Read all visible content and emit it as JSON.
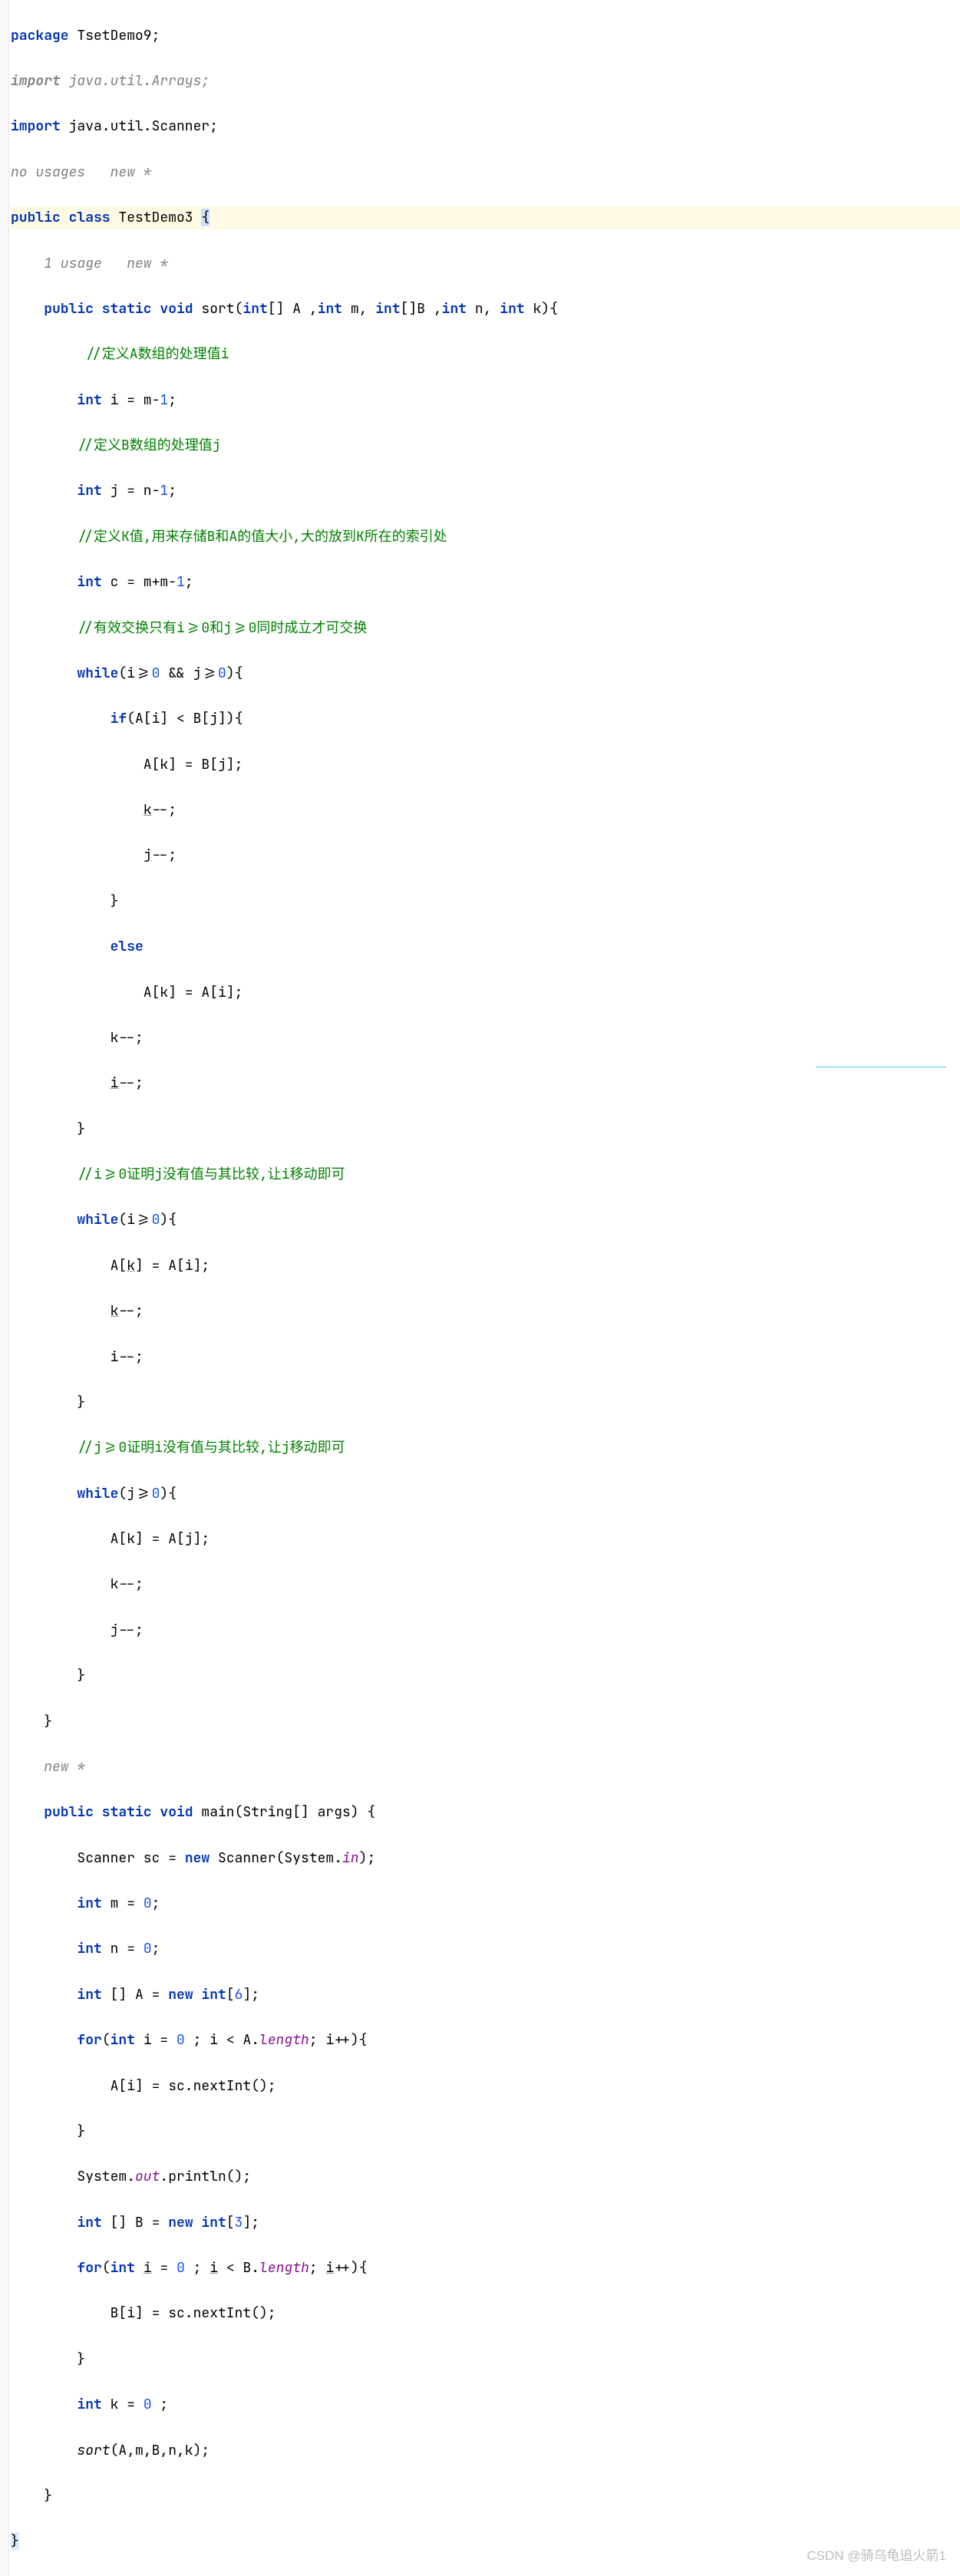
{
  "code": {
    "l1_kw": "package",
    "l1_pkg": " TsetDemo9;",
    "l2_kw": "import",
    "l2_pkg": " java.util.Arrays;",
    "l3_kw": "import",
    "l3_pkg": " java.util.Scanner;",
    "l4_hint": "no usages   new *",
    "l5_kw1": "public class",
    "l5_name": " TestDemo3 ",
    "l5_brace": "{",
    "l6_hint": "    1 usage   new *",
    "l7_kw1": "    public static void",
    "l7_name": " sort(",
    "l7_kw2": "int",
    "l7_p1": "[] A ,",
    "l7_kw3": "int",
    "l7_p2": " m, ",
    "l7_kw4": "int",
    "l7_p3": "[]B ,",
    "l7_kw5": "int",
    "l7_p4": " n, ",
    "l7_kw6": "int",
    "l7_p5": " k){",
    "l8": "         //定义A数组的处理值i",
    "l9_kw": "        int",
    "l9_rest": " i = m-",
    "l9_num": "1",
    "l9_semi": ";",
    "l10": "        //定义B数组的处理值j",
    "l11_kw": "        int",
    "l11_rest": " j = n-",
    "l11_num": "1",
    "l11_semi": ";",
    "l12": "        //定义K值,用来存储B和A的值大小,大的放到K所在的索引处",
    "l13_kw": "        int",
    "l13_rest": " c = m+m-",
    "l13_num": "1",
    "l13_semi": ";",
    "l14": "        //有效交换只有i>=0和j>=0同时成立才可交换",
    "l15_kw": "        while",
    "l15_rest": "(i>=",
    "l15_n1": "0",
    "l15_mid": " && j>=",
    "l15_n2": "0",
    "l15_end": "){",
    "l16_kw": "            if",
    "l16_rest": "(A[i] < B[j]){",
    "l17": "                A[k] = B[j];",
    "l18_a": "                ",
    "l18_b": "k",
    "l18_c": "--;",
    "l19_a": "                ",
    "l19_b": "j",
    "l19_c": "--;",
    "l20": "            }",
    "l21_kw": "            else",
    "l22": "                A[k] = A[i];",
    "l23": "            k--;",
    "l24_a": "            ",
    "l24_b": "i",
    "l24_c": "--;",
    "l25": "        }",
    "l26": "        //i>=0证明j没有值与其比较,让i移动即可",
    "l27_kw": "        while",
    "l27_rest": "(i>=",
    "l27_n": "0",
    "l27_end": "){",
    "l28_a": "            A[",
    "l28_b": "k",
    "l28_c": "] = A[i];",
    "l29_a": "            ",
    "l29_b": "k",
    "l29_c": "--;",
    "l30": "            i--;",
    "l31": "        }",
    "l32": "        //j>=0证明i没有值与其比较,让j移动即可",
    "l33_kw": "        while",
    "l33_rest": "(j>=",
    "l33_n": "0",
    "l33_end": "){",
    "l34": "            A[k] = A[j];",
    "l35": "            k--;",
    "l36": "            j--;",
    "l37": "        }",
    "l38": "    }",
    "l39_hint": "    new *",
    "l40_kw": "    public static void",
    "l40_name": " main(String[] args) {",
    "l41a": "        Scanner sc = ",
    "l41_kw": "new",
    "l41b": " Scanner(System.",
    "l41_field": "in",
    "l41c": ");",
    "l42_kw": "        int",
    "l42_rest": " m = ",
    "l42_n": "0",
    "l42_semi": ";",
    "l43_kw": "        int",
    "l43_rest": " n = ",
    "l43_n": "0",
    "l43_semi": ";",
    "l44_kw": "        int",
    "l44_a": " [] A = ",
    "l44_kw2": "new int",
    "l44_b": "[",
    "l44_n": "6",
    "l44_c": "];",
    "l45_kw": "        for",
    "l45_a": "(",
    "l45_kw2": "int",
    "l45_b": " i = ",
    "l45_n": "0",
    "l45_c": " ; i < A.",
    "l45_field": "length",
    "l45_d": "; i++){",
    "l46": "            A[i] = sc.nextInt();",
    "l47": "        }",
    "l48a": "        System.",
    "l48_field": "out",
    "l48b": ".println();",
    "l49_kw": "        int",
    "l49_a": " [] B = ",
    "l49_kw2": "new int",
    "l49_b": "[",
    "l49_n": "3",
    "l49_c": "];",
    "l50_kw": "        for",
    "l50_a": "(",
    "l50_kw2": "int",
    "l50_b": " ",
    "l50_u": "i",
    "l50_c": " = ",
    "l50_n": "0",
    "l50_d": " ; ",
    "l50_u2": "i",
    "l50_e": " < B.",
    "l50_field": "length",
    "l50_f": "; ",
    "l50_u3": "i",
    "l50_g": "++){",
    "l51": "            B[i] = sc.nextInt();",
    "l52": "        }",
    "l53_kw": "        int",
    "l53_rest": " k = ",
    "l53_n": "0",
    "l53_semi": " ;",
    "l54_a": "        ",
    "l54_call": "sort",
    "l54_b": "(A,m,B,n,k);",
    "l55": "    }",
    "l56": "}"
  },
  "watermark": "CSDN @骑乌龟追火箭1"
}
